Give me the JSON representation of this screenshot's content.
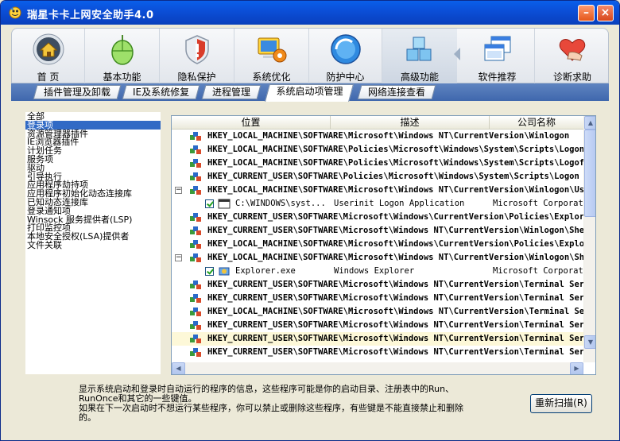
{
  "window": {
    "title": "瑞星卡卡上网安全助手4.0",
    "min_label": "–",
    "close_label": "×"
  },
  "toolbar": {
    "items": [
      {
        "label": "首  页",
        "icon": "home-icon"
      },
      {
        "label": "基本功能",
        "icon": "mouse-icon"
      },
      {
        "label": "隐私保护",
        "icon": "shield-icon"
      },
      {
        "label": "系统优化",
        "icon": "computer-gear-icon"
      },
      {
        "label": "防护中心",
        "icon": "globe-icon"
      },
      {
        "label": "高级功能",
        "icon": "cubes-icon"
      },
      {
        "label": "软件推荐",
        "icon": "windows-icon"
      },
      {
        "label": "诊断求助",
        "icon": "heart-hand-icon"
      }
    ]
  },
  "subtabs": [
    {
      "label": "插件管理及卸载"
    },
    {
      "label": "IE及系统修复"
    },
    {
      "label": "进程管理"
    },
    {
      "label": "系统启动项管理",
      "active": true
    },
    {
      "label": "网络连接查看"
    }
  ],
  "sidebar": {
    "items": [
      "全部",
      "登录项",
      "资源管理器插件",
      "IE浏览器插件",
      "计划任务",
      "服务项",
      "驱动",
      "引导执行",
      "应用程序劫持项",
      "应用程序初始化动态连接库",
      "已知动态连接库",
      "登录通知项",
      "Winsock 服务提供者(LSP)",
      "打印监控项",
      "本地安全授权(LSA)提供者",
      "文件关联"
    ],
    "selected_index": 1
  },
  "listview": {
    "columns": [
      "位置",
      "描述",
      "公司名称"
    ],
    "rows": [
      {
        "type": "key",
        "text": "HKEY_LOCAL_MACHINE\\SOFTWARE\\Microsoft\\Windows NT\\CurrentVersion\\Winlogon"
      },
      {
        "type": "key",
        "text": "HKEY_LOCAL_MACHINE\\SOFTWARE\\Policies\\Microsoft\\Windows\\System\\Scripts\\Logon"
      },
      {
        "type": "key",
        "text": "HKEY_LOCAL_MACHINE\\SOFTWARE\\Policies\\Microsoft\\Windows\\System\\Scripts\\Logoff"
      },
      {
        "type": "key",
        "text": "HKEY_CURRENT_USER\\SOFTWARE\\Policies\\Microsoft\\Windows\\System\\Scripts\\Logon"
      },
      {
        "type": "key",
        "expanded": true,
        "text": "HKEY_LOCAL_MACHINE\\SOFTWARE\\Microsoft\\Windows NT\\CurrentVersion\\Winlogon\\Userinit"
      },
      {
        "type": "item",
        "icon": "window-file-icon",
        "text": "C:\\WINDOWS\\syst...",
        "desc": "Userinit Logon Application",
        "company": "Microsoft Corporation"
      },
      {
        "type": "key",
        "text": "HKEY_CURRENT_USER\\SOFTWARE\\Microsoft\\Windows\\CurrentVersion\\Policies\\Explorer\\Run"
      },
      {
        "type": "key",
        "text": "HKEY_CURRENT_USER\\SOFTWARE\\Microsoft\\Windows NT\\CurrentVersion\\Winlogon\\Shell"
      },
      {
        "type": "key",
        "text": "HKEY_LOCAL_MACHINE\\SOFTWARE\\Microsoft\\Windows\\CurrentVersion\\Policies\\Explorer\\Run"
      },
      {
        "type": "key",
        "expanded": true,
        "text": "HKEY_LOCAL_MACHINE\\SOFTWARE\\Microsoft\\Windows NT\\CurrentVersion\\Winlogon\\Shell"
      },
      {
        "type": "item",
        "icon": "explorer-icon",
        "text": "Explorer.exe",
        "desc": "Windows Explorer",
        "company": "Microsoft Corporation"
      },
      {
        "type": "key",
        "text": "HKEY_CURRENT_USER\\SOFTWARE\\Microsoft\\Windows NT\\CurrentVersion\\Terminal Server"
      },
      {
        "type": "key",
        "text": "HKEY_CURRENT_USER\\SOFTWARE\\Microsoft\\Windows NT\\CurrentVersion\\Terminal Server"
      },
      {
        "type": "key",
        "text": "HKEY_LOCAL_MACHINE\\SOFTWARE\\Microsoft\\Windows NT\\CurrentVersion\\Terminal Server"
      },
      {
        "type": "key",
        "text": "HKEY_CURRENT_USER\\SOFTWARE\\Microsoft\\Windows NT\\CurrentVersion\\Terminal Server"
      },
      {
        "type": "key",
        "highlight": true,
        "text": "HKEY_CURRENT_USER\\SOFTWARE\\Microsoft\\Windows NT\\CurrentVersion\\Terminal Server"
      },
      {
        "type": "key",
        "text": "HKEY_CURRENT_USER\\SOFTWARE\\Microsoft\\Windows NT\\CurrentVersion\\Terminal Server"
      }
    ]
  },
  "description": {
    "line1": "显示系统启动和登录时自动运行的程序的信息，这些程序可能是你的启动目录、注册表中的Run、",
    "line2": "RunOnce和其它的一些键值。",
    "line3": "如果在下一次启动时不想运行某些程序，你可以禁止或删除这些程序，有些键是不能直接禁止和删除",
    "line4": "的。"
  },
  "buttons": {
    "rescan": "重新扫描(R)"
  },
  "colors": {
    "titlebar": "#0a50dc",
    "selection": "#316ac5",
    "tabbar": "#4a71b4"
  }
}
